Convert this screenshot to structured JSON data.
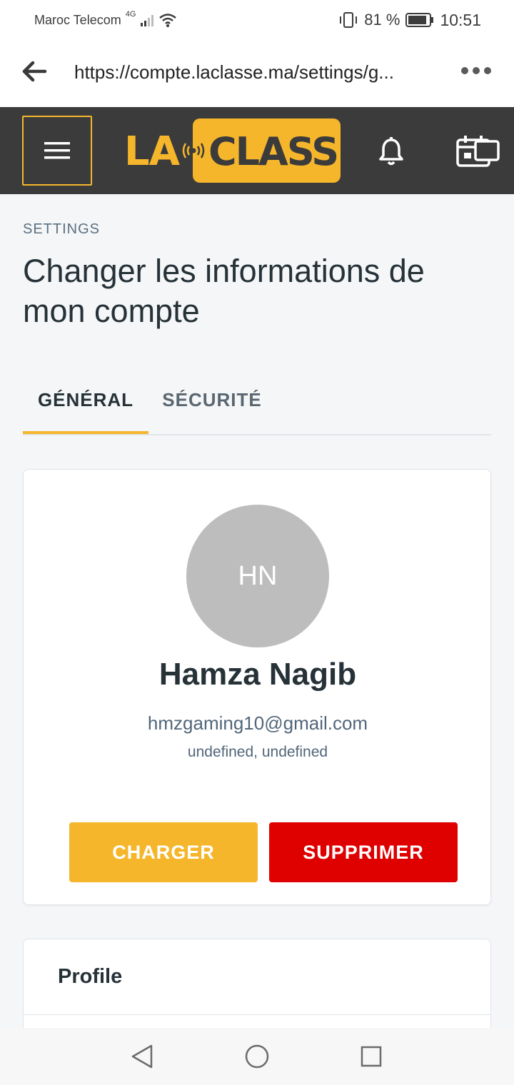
{
  "status_bar": {
    "carrier": "Maroc Telecom",
    "network": "4G",
    "battery": "81 %",
    "time": "10:51"
  },
  "browser": {
    "url": "https://compte.laclasse.ma/settings/g..."
  },
  "header": {
    "logo_left": "LA",
    "logo_right": "CLASSE",
    "accent_color": "#f5b62b",
    "background_color": "#3b3b3b"
  },
  "page": {
    "breadcrumb": "SETTINGS",
    "title": "Changer les informations de mon compte"
  },
  "tabs": [
    {
      "label": "GÉNÉRAL",
      "active": true
    },
    {
      "label": "SÉCURITÉ",
      "active": false
    }
  ],
  "user_card": {
    "initials": "HN",
    "name": "Hamza Nagib",
    "email": "hmzgaming10@gmail.com",
    "location": "undefined, undefined",
    "charger_label": "CHARGER",
    "supprimer_label": "SUPPRIMER",
    "charger_color": "#f5b62b",
    "supprimer_color": "#df0000"
  },
  "profile_section": {
    "title": "Profile"
  },
  "icons": {
    "back": "arrow-left-icon",
    "more": "more-dots-icon",
    "menu": "hamburger-icon",
    "bell": "bell-icon",
    "calendar": "calendar-icon",
    "nav_back": "triangle-back-icon",
    "nav_home": "circle-home-icon",
    "nav_recent": "square-recent-icon"
  }
}
